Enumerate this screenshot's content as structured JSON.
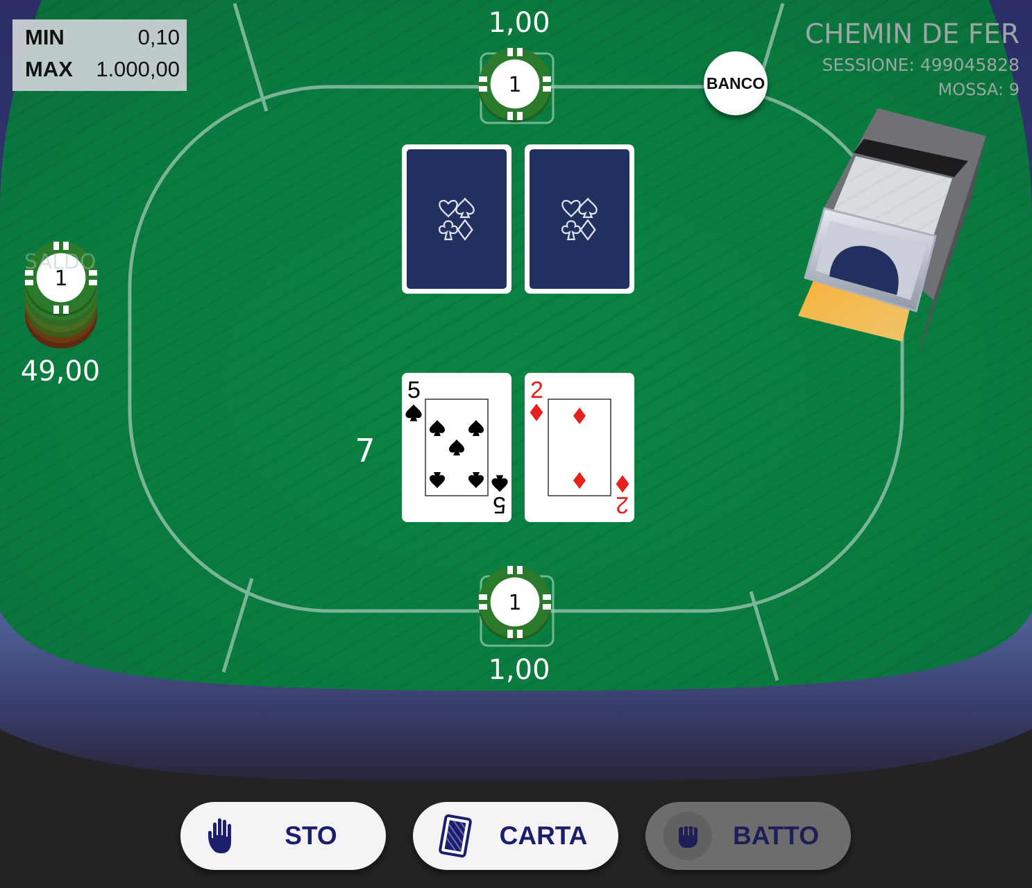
{
  "limits": {
    "min_label": "MIN",
    "min_value": "0,10",
    "max_label": "MAX",
    "max_value": "1.000,00"
  },
  "header": {
    "game_title": "CHEMIN DE FER",
    "session": "SESSIONE: 499045828",
    "move": "MOSSA: 9"
  },
  "banker": {
    "label": "BANCO",
    "bet_amount": "1,00",
    "chip_value": "1"
  },
  "player": {
    "bet_amount": "1,00",
    "chip_value": "1",
    "score": "7"
  },
  "balance": {
    "label_partial": "SALDO",
    "amount": "49,00",
    "chip_value": "1"
  },
  "banker_cards": [
    {
      "face": "down"
    },
    {
      "face": "down"
    }
  ],
  "player_cards": [
    {
      "rank": "5",
      "suit": "spades",
      "color": "#000000"
    },
    {
      "rank": "2",
      "suit": "diamonds",
      "color": "#e8201b"
    }
  ],
  "actions": [
    {
      "label": "STO",
      "icon": "hand-stop-icon",
      "enabled": true
    },
    {
      "label": "CARTA",
      "icon": "card-icon",
      "enabled": true
    },
    {
      "label": "BATTO",
      "icon": "fist-icon",
      "enabled": false
    }
  ],
  "colors": {
    "felt": "#0b8042",
    "rail": "#2b2f6e",
    "chip_green": "#2b7a2b",
    "card_back": "#22305f",
    "red_suit": "#e8201b"
  }
}
